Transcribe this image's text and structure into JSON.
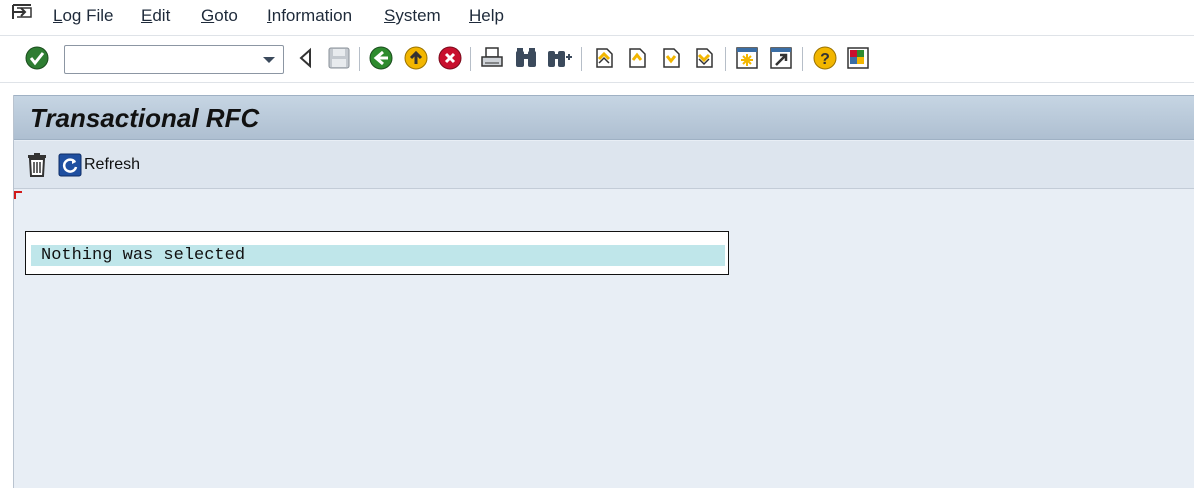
{
  "menu": {
    "items": [
      {
        "underline": "L",
        "rest": "og File"
      },
      {
        "underline": "E",
        "rest": "dit"
      },
      {
        "underline": "G",
        "rest": "oto"
      },
      {
        "underline": "I",
        "rest": "nformation"
      },
      {
        "underline": "S",
        "rest": "ystem"
      },
      {
        "underline": "H",
        "rest": "elp"
      }
    ]
  },
  "toolbar": {
    "command_field_value": "",
    "icons": [
      "enter-icon",
      "back-arrow-icon",
      "save-icon",
      "back-icon",
      "exit-icon",
      "cancel-icon",
      "print-icon",
      "find-icon",
      "find-next-icon",
      "first-page-icon",
      "previous-page-icon",
      "next-page-icon",
      "last-page-icon",
      "create-session-icon",
      "shortcut-icon",
      "help-icon",
      "customize-layout-icon"
    ]
  },
  "page": {
    "title": "Transactional RFC"
  },
  "app_toolbar": {
    "delete_icon": "trash-icon",
    "refresh_label": "Refresh"
  },
  "message": {
    "text": "Nothing was selected"
  },
  "colors": {
    "title_bar": "#b8c9da",
    "content_bg": "#e8eef5",
    "message_highlight": "#bfe6ea",
    "accent_green": "#2e8b2e",
    "accent_red": "#c8102e",
    "accent_yellow": "#f2b600"
  }
}
